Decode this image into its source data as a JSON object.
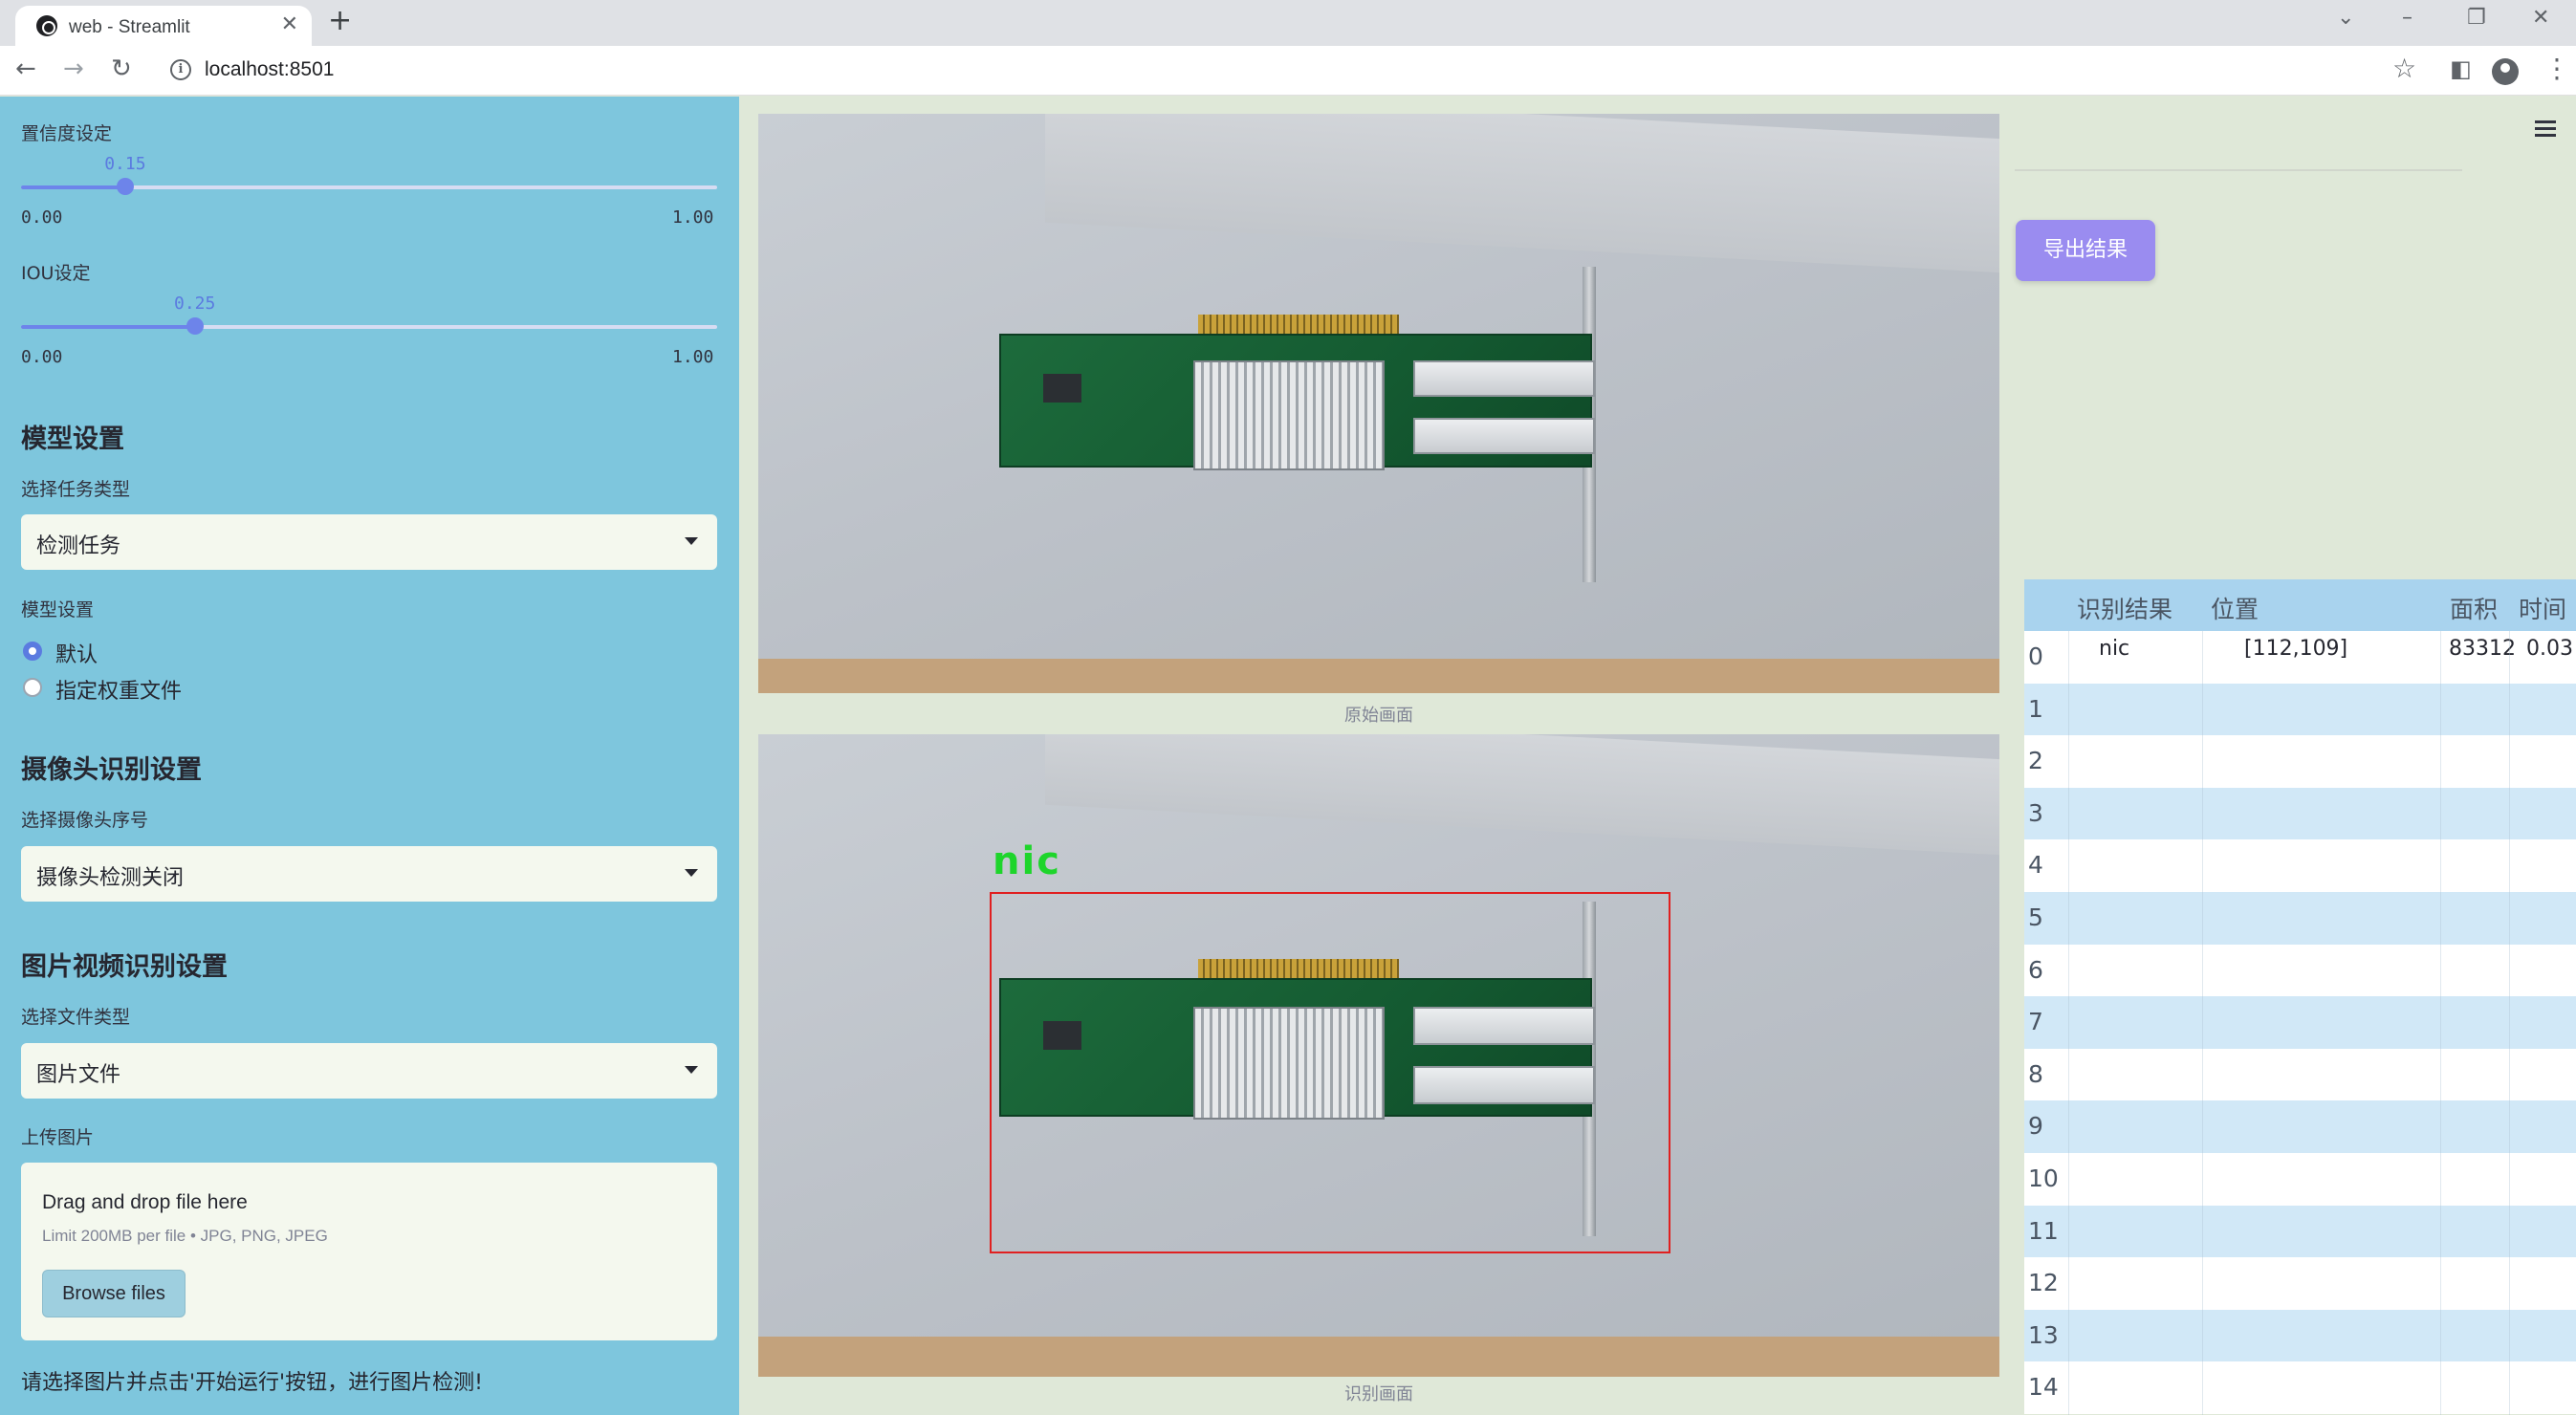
{
  "browser": {
    "tab_title": "web - Streamlit",
    "url": "localhost:8501"
  },
  "sidebar": {
    "confidence": {
      "label": "置信度设定",
      "value_text": "0.15",
      "value": 0.15,
      "min": "0.00",
      "max": "1.00"
    },
    "iou": {
      "label": "IOU设定",
      "value_text": "0.25",
      "value": 0.25,
      "min": "0.00",
      "max": "1.00"
    },
    "model_section": "模型设置",
    "task_label": "选择任务类型",
    "task_value": "检测任务",
    "model_label": "模型设置",
    "radio_default": "默认",
    "radio_custom": "指定权重文件",
    "camera_section": "摄像头识别设置",
    "camera_label": "选择摄像头序号",
    "camera_value": "摄像头检测关闭",
    "media_section": "图片视频识别设置",
    "filetype_label": "选择文件类型",
    "filetype_value": "图片文件",
    "upload_label": "上传图片",
    "uploader": {
      "title": "Drag and drop file here",
      "limit": "Limit 200MB per file • JPG, PNG, JPEG",
      "button": "Browse files"
    },
    "footer": "请选择图片并点击'开始运行'按钮，进行图片检测!"
  },
  "main": {
    "original_caption": "原始画面",
    "result_caption": "识别画面",
    "detection_label": "nic"
  },
  "right": {
    "export_button": "导出结果",
    "table": {
      "headers": [
        "识别结果",
        "位置",
        "面积",
        "时间"
      ],
      "rows": [
        {
          "index": "0",
          "result": "nic",
          "position": "[112,109]",
          "area": "83312",
          "time": "0.03"
        },
        {
          "index": "1"
        },
        {
          "index": "2"
        },
        {
          "index": "3"
        },
        {
          "index": "4"
        },
        {
          "index": "5"
        },
        {
          "index": "6"
        },
        {
          "index": "7"
        },
        {
          "index": "8"
        },
        {
          "index": "9"
        },
        {
          "index": "10"
        },
        {
          "index": "11"
        },
        {
          "index": "12"
        },
        {
          "index": "13"
        },
        {
          "index": "14"
        }
      ]
    }
  },
  "colors": {
    "sidebar_bg": "#7ec6dd",
    "accent": "#6d84ea",
    "export_button": "#9a8cf0",
    "detection_box": "#e02020",
    "detection_label": "#1ed52b"
  }
}
